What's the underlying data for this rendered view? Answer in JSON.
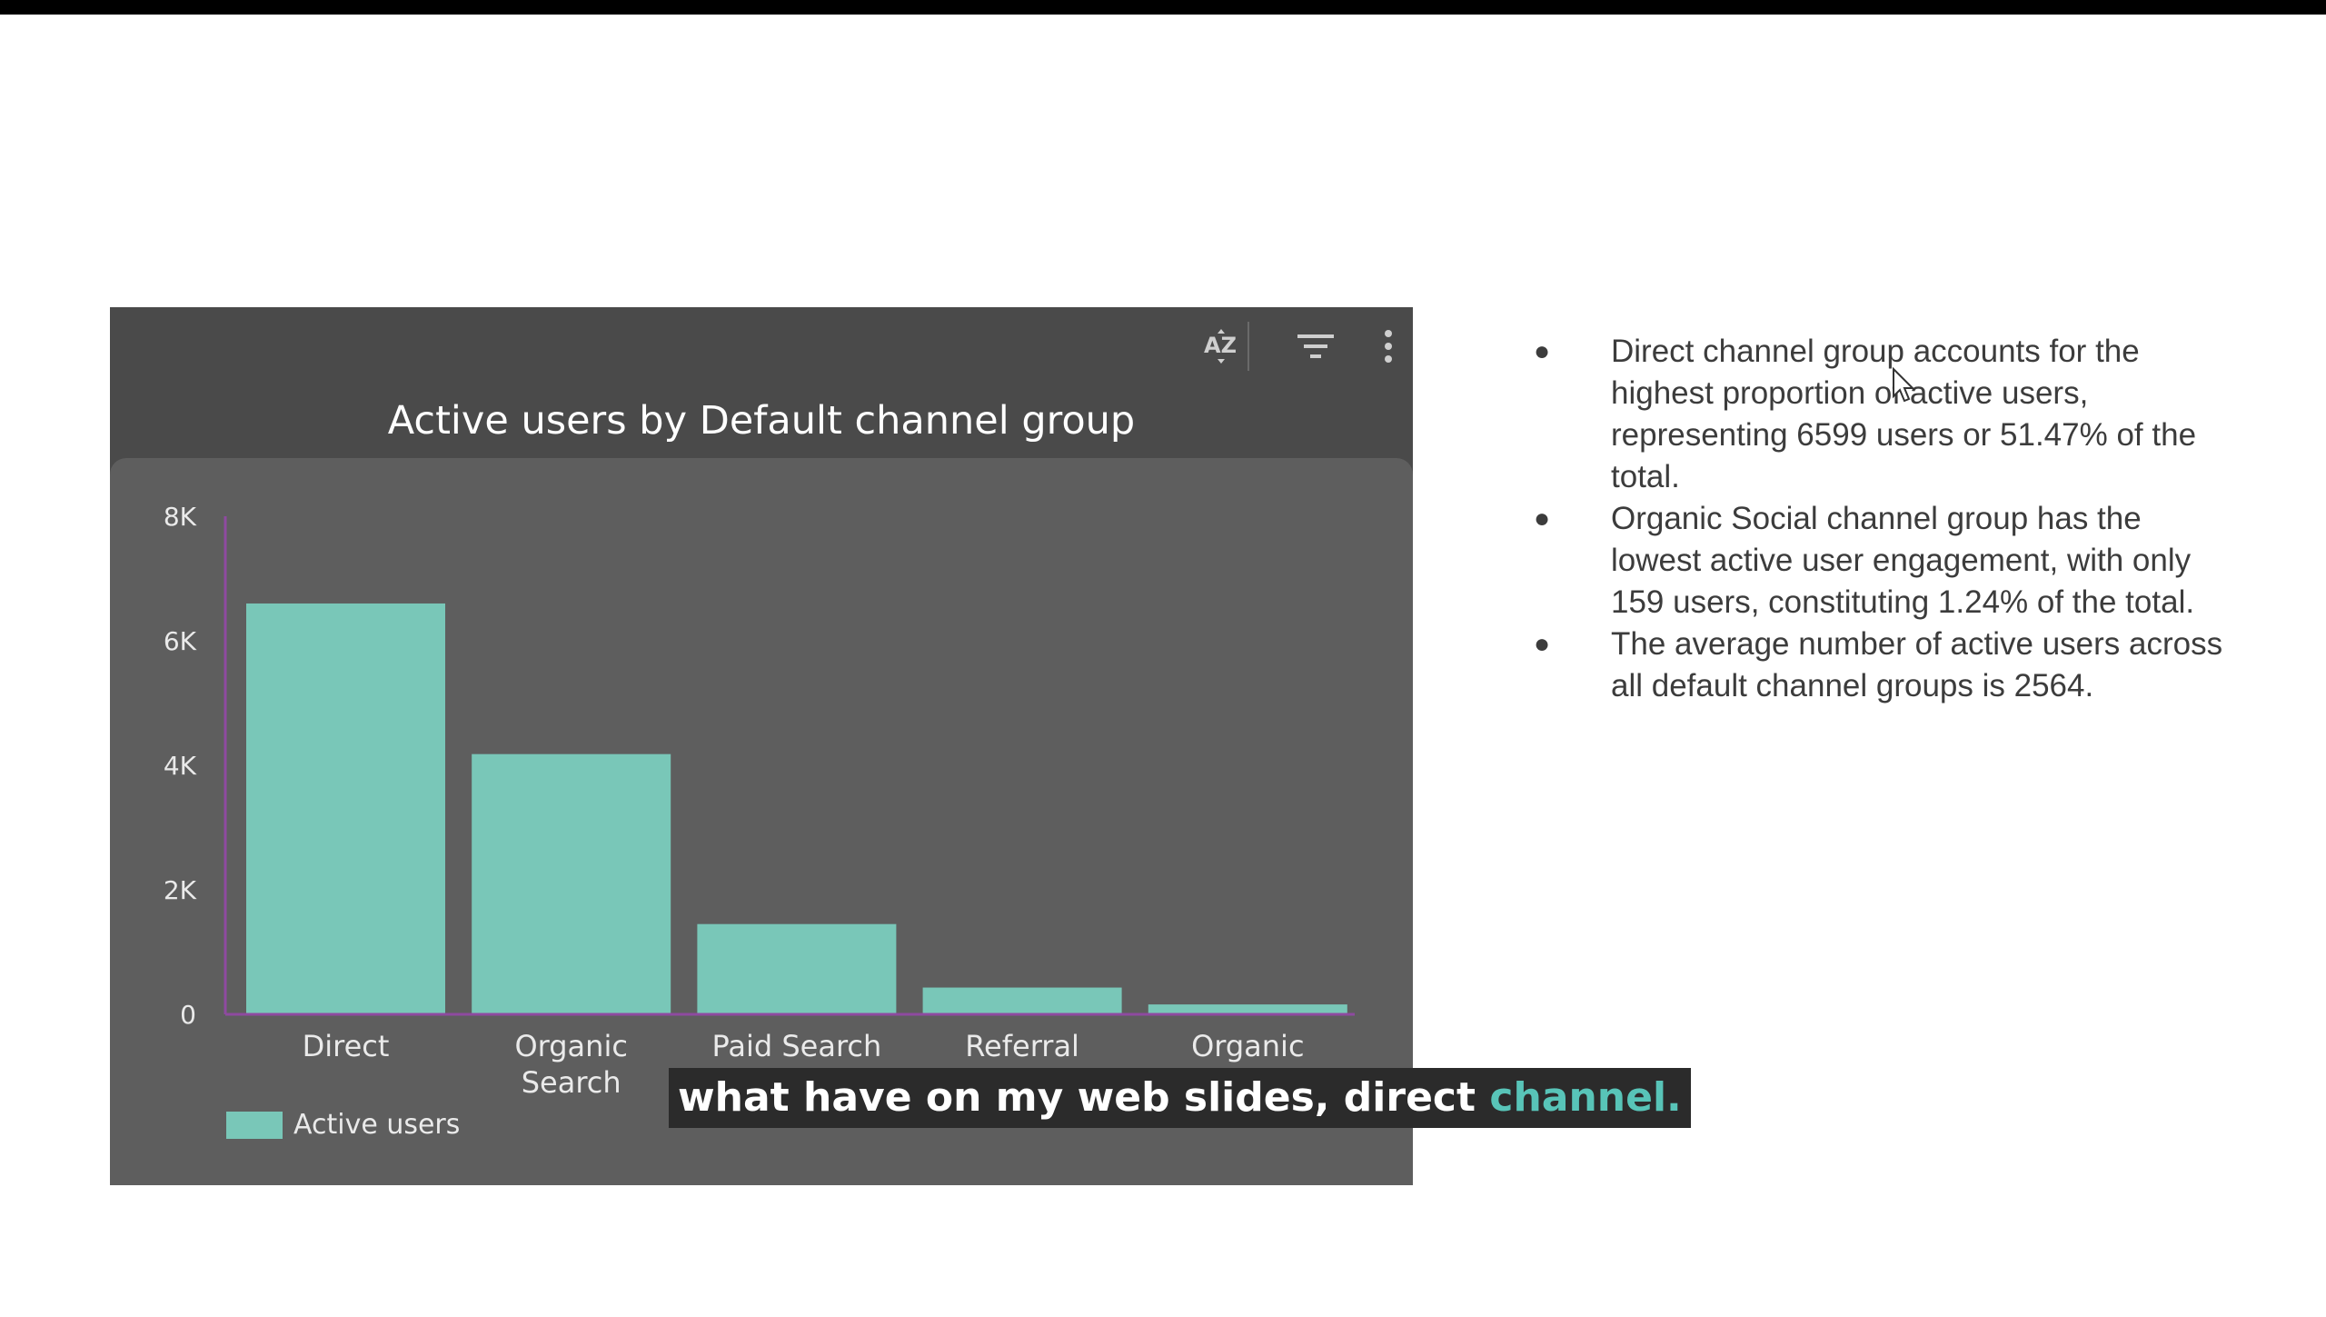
{
  "chart_data": {
    "type": "bar",
    "title": "Active users by Default channel group",
    "categories": [
      "Direct",
      "Organic Search",
      "Paid Search",
      "Referral",
      "Organic Social"
    ],
    "category_lines": [
      [
        "Direct"
      ],
      [
        "Organic",
        "Search"
      ],
      [
        "Paid Search"
      ],
      [
        "Referral"
      ],
      [
        "Organic",
        "Social"
      ]
    ],
    "series": [
      {
        "name": "Active users",
        "values": [
          6599,
          4180,
          1450,
          430,
          159
        ],
        "color": "#79c7b8"
      }
    ],
    "y_ticks": [
      {
        "value": 0,
        "label": "0"
      },
      {
        "value": 2000,
        "label": "2K"
      },
      {
        "value": 4000,
        "label": "4K"
      },
      {
        "value": 6000,
        "label": "6K"
      },
      {
        "value": 8000,
        "label": "8K"
      }
    ],
    "ylim": [
      0,
      8000
    ],
    "xlabel": "",
    "ylabel": "",
    "grid": false,
    "legend": "bottom-left",
    "axis_color": "#8e4aa0"
  },
  "toolbar": {
    "sort_icon": "sort-az-icon",
    "filter_icon": "filter-icon",
    "more_icon": "more-vert-icon"
  },
  "legend": {
    "label": "Active users"
  },
  "bullets": [
    "Direct channel group accounts for the highest proportion of active users, representing 6599 users or 51.47% of the total.",
    "Organic Social channel group has the lowest active user engagement, with only 159 users, constituting 1.24% of the total.",
    "The average number of active users across all default channel groups is 2564."
  ],
  "bullet_symbol": "●",
  "caption": {
    "text": "what have on my web slides, direct ",
    "highlight": "channel."
  }
}
